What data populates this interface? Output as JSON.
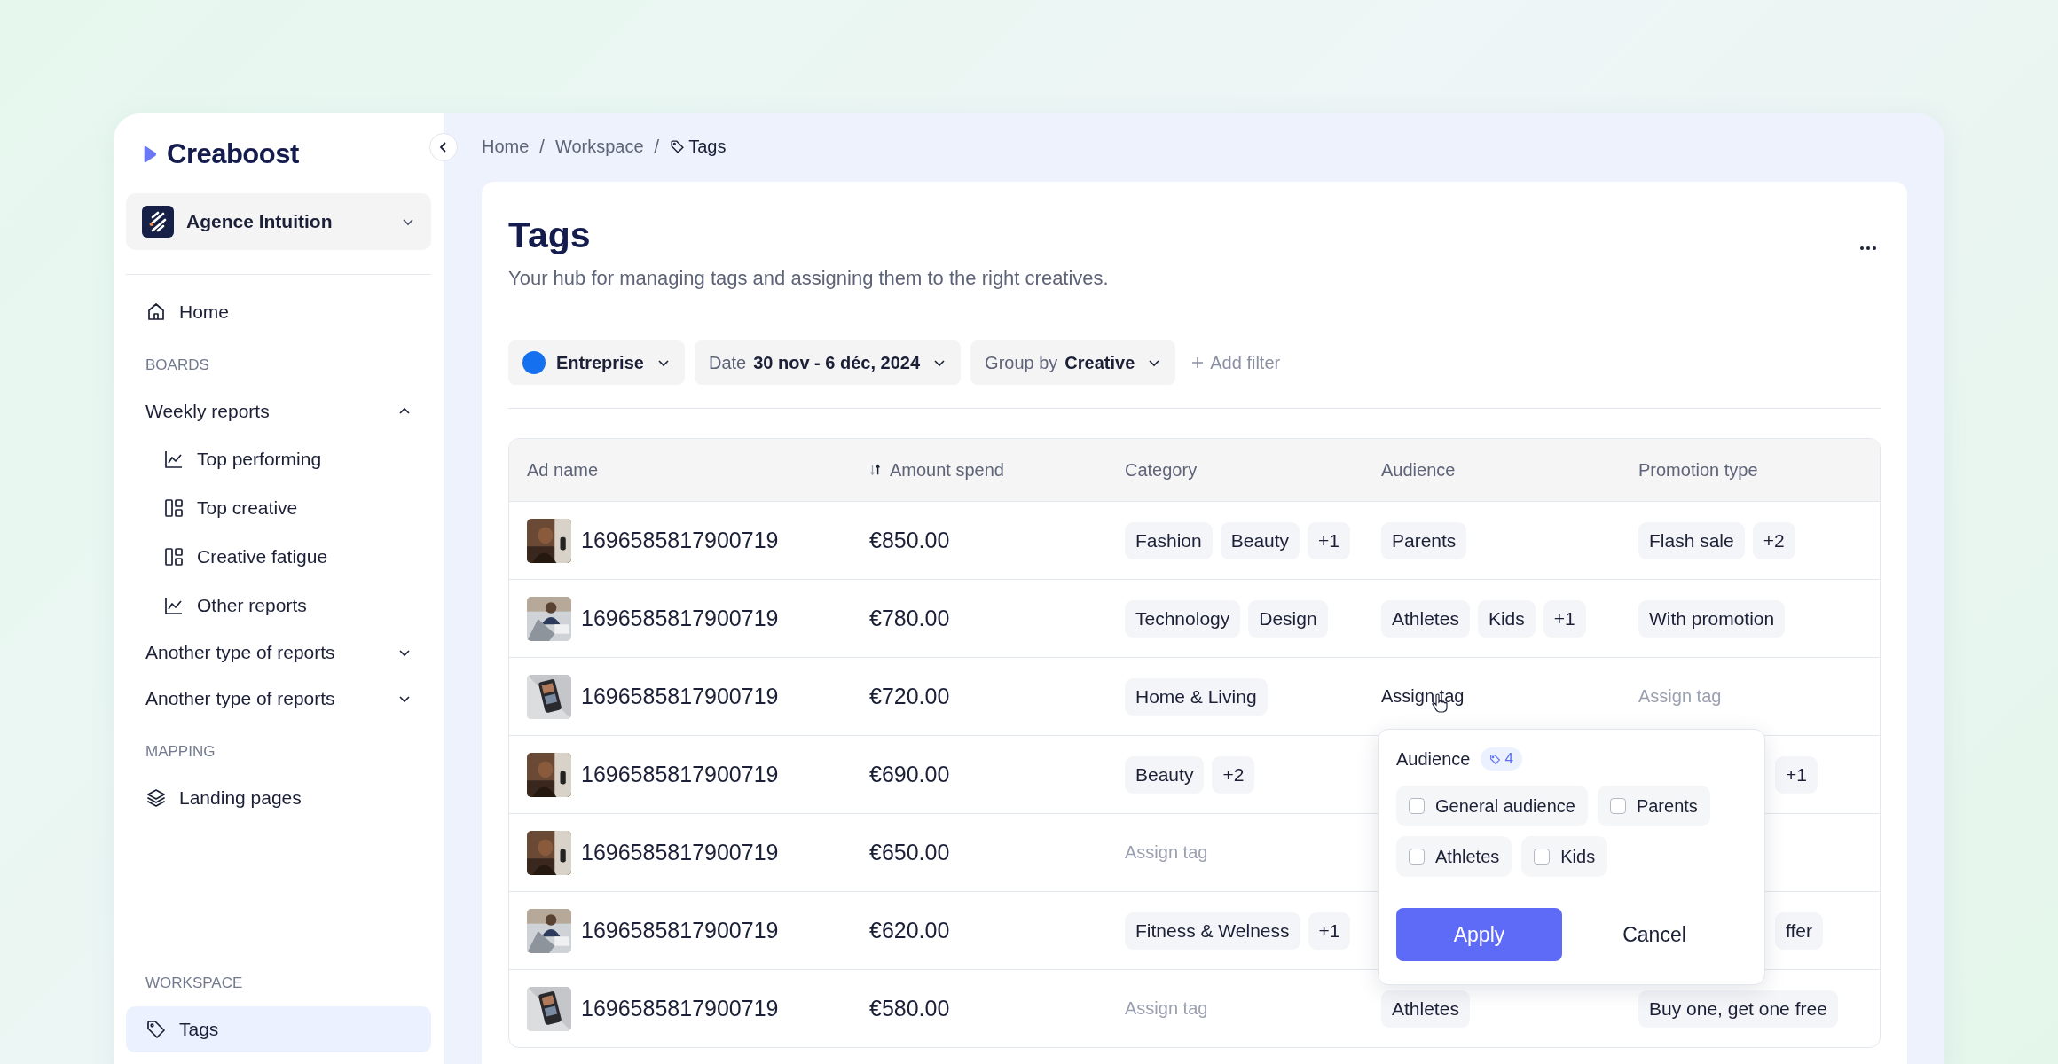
{
  "sidebar": {
    "brand": "Creaboost",
    "workspace": "Agence Intuition",
    "items": [
      {
        "kind": "link",
        "label": "Home",
        "selected": false
      },
      {
        "kind": "section",
        "label": "BOARDS"
      },
      {
        "kind": "group",
        "label": "Weekly reports",
        "expanded": true,
        "children": [
          {
            "label": "Top performing"
          },
          {
            "label": "Top creative"
          },
          {
            "label": "Creative fatigue"
          },
          {
            "label": "Other reports"
          }
        ]
      },
      {
        "kind": "group",
        "label": "Another type of reports",
        "expanded": false
      },
      {
        "kind": "group",
        "label": "Another type of reports",
        "expanded": false
      },
      {
        "kind": "section",
        "label": "MAPPING"
      },
      {
        "kind": "link",
        "label": "Landing pages",
        "selected": false
      },
      {
        "kind": "spacer"
      },
      {
        "kind": "section",
        "label": "WORKSPACE"
      },
      {
        "kind": "link",
        "label": "Tags",
        "selected": true
      }
    ]
  },
  "breadcrumb": [
    {
      "kind": "link",
      "label": "Home"
    },
    {
      "kind": "separator",
      "label": "/"
    },
    {
      "kind": "link",
      "label": "Workspace"
    },
    {
      "kind": "separator",
      "label": "/"
    },
    {
      "kind": "current",
      "label": "Tags"
    }
  ],
  "page": {
    "title": "Tags",
    "subtitle": "Your hub for managing tags and assigning them to the right creatives."
  },
  "filters": [
    {
      "kind": "entity",
      "value": "Entreprise",
      "color": "#1570ef"
    },
    {
      "kind": "field",
      "label": "Date",
      "value": "30 nov - 6 déc, 2024"
    },
    {
      "kind": "field",
      "label": "Group by",
      "value": "Creative"
    },
    {
      "kind": "add",
      "label": "Add filter"
    }
  ],
  "table": {
    "columns": [
      {
        "label": "Ad name",
        "sortable": false
      },
      {
        "label": "Amount spend",
        "sortable": true
      },
      {
        "label": "Category",
        "sortable": false
      },
      {
        "label": "Audience",
        "sortable": false
      },
      {
        "label": "Promotion type",
        "sortable": false
      }
    ],
    "rows": [
      {
        "ad": "1696585817900719",
        "amount": "€850.00",
        "category": {
          "tags": [
            "Fashion",
            "Beauty",
            "+1"
          ]
        },
        "audience": {
          "tags": [
            "Parents"
          ]
        },
        "promotion": {
          "tags": [
            "Flash sale",
            "+2"
          ]
        }
      },
      {
        "ad": "1696585817900719",
        "amount": "€780.00",
        "category": {
          "tags": [
            "Technology",
            "Design"
          ]
        },
        "audience": {
          "tags": [
            "Athletes",
            "Kids",
            "+1"
          ]
        },
        "promotion": {
          "tags": [
            "With promotion"
          ]
        }
      },
      {
        "ad": "1696585817900719",
        "amount": "€720.00",
        "category": {
          "tags": [
            "Home & Living"
          ]
        },
        "audience": {
          "action": "Assign tag",
          "hovered": true,
          "popup_open": true
        },
        "promotion": {
          "action": "Assign tag",
          "hovered": false
        }
      },
      {
        "ad": "1696585817900719",
        "amount": "€690.00",
        "category": {
          "tags": [
            "Beauty",
            "+2"
          ]
        },
        "promotion": {
          "tags": [
            "+1"
          ]
        }
      },
      {
        "ad": "1696585817900719",
        "amount": "€650.00",
        "category": {
          "action": "Assign tag",
          "hovered": false
        }
      },
      {
        "ad": "1696585817900719",
        "amount": "€620.00",
        "category": {
          "tags": [
            "Fitness & Welness",
            "+1"
          ]
        },
        "promotion": {
          "tags": [
            "ffer"
          ]
        }
      },
      {
        "ad": "1696585817900719",
        "amount": "€580.00",
        "category": {
          "action": "Assign tag",
          "hovered": false
        },
        "audience": {
          "tags": [
            "Athletes"
          ]
        },
        "promotion": {
          "tags": [
            "Buy one, get one free"
          ]
        }
      }
    ]
  },
  "tag_popup": {
    "title": "Audience",
    "count": "4",
    "options": [
      {
        "label": "General audience",
        "checked": false
      },
      {
        "label": "Parents",
        "checked": false
      },
      {
        "label": "Athletes",
        "checked": false
      },
      {
        "label": "Kids",
        "checked": false
      }
    ],
    "apply": "Apply",
    "cancel": "Cancel"
  }
}
